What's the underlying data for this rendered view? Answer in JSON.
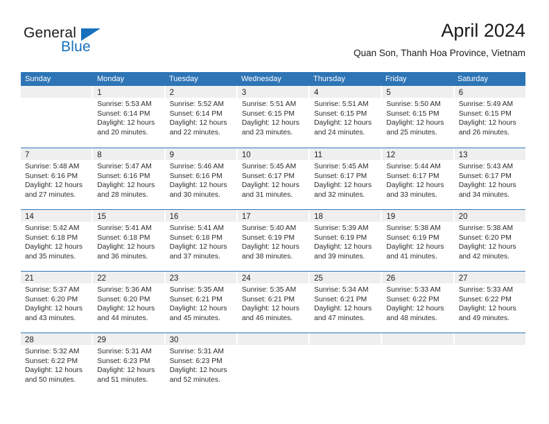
{
  "logo": {
    "word_top": "General",
    "word_bottom": "Blue",
    "triangle_color": "#1670bc",
    "blue_text_color": "#1670bc"
  },
  "header": {
    "title": "April 2024",
    "subtitle": "Quan Son, Thanh Hoa Province, Vietnam"
  },
  "theme": {
    "header_blue": "#2e75b6",
    "daynum_band": "#efefef",
    "text": "#2b2b2b"
  },
  "calendar": {
    "weekdays": [
      "Sunday",
      "Monday",
      "Tuesday",
      "Wednesday",
      "Thursday",
      "Friday",
      "Saturday"
    ],
    "weeks": [
      [
        {
          "day": "",
          "lines": []
        },
        {
          "day": "1",
          "lines": [
            "Sunrise: 5:53 AM",
            "Sunset: 6:14 PM",
            "Daylight: 12 hours",
            "and 20 minutes."
          ]
        },
        {
          "day": "2",
          "lines": [
            "Sunrise: 5:52 AM",
            "Sunset: 6:14 PM",
            "Daylight: 12 hours",
            "and 22 minutes."
          ]
        },
        {
          "day": "3",
          "lines": [
            "Sunrise: 5:51 AM",
            "Sunset: 6:15 PM",
            "Daylight: 12 hours",
            "and 23 minutes."
          ]
        },
        {
          "day": "4",
          "lines": [
            "Sunrise: 5:51 AM",
            "Sunset: 6:15 PM",
            "Daylight: 12 hours",
            "and 24 minutes."
          ]
        },
        {
          "day": "5",
          "lines": [
            "Sunrise: 5:50 AM",
            "Sunset: 6:15 PM",
            "Daylight: 12 hours",
            "and 25 minutes."
          ]
        },
        {
          "day": "6",
          "lines": [
            "Sunrise: 5:49 AM",
            "Sunset: 6:15 PM",
            "Daylight: 12 hours",
            "and 26 minutes."
          ]
        }
      ],
      [
        {
          "day": "7",
          "lines": [
            "Sunrise: 5:48 AM",
            "Sunset: 6:16 PM",
            "Daylight: 12 hours",
            "and 27 minutes."
          ]
        },
        {
          "day": "8",
          "lines": [
            "Sunrise: 5:47 AM",
            "Sunset: 6:16 PM",
            "Daylight: 12 hours",
            "and 28 minutes."
          ]
        },
        {
          "day": "9",
          "lines": [
            "Sunrise: 5:46 AM",
            "Sunset: 6:16 PM",
            "Daylight: 12 hours",
            "and 30 minutes."
          ]
        },
        {
          "day": "10",
          "lines": [
            "Sunrise: 5:45 AM",
            "Sunset: 6:17 PM",
            "Daylight: 12 hours",
            "and 31 minutes."
          ]
        },
        {
          "day": "11",
          "lines": [
            "Sunrise: 5:45 AM",
            "Sunset: 6:17 PM",
            "Daylight: 12 hours",
            "and 32 minutes."
          ]
        },
        {
          "day": "12",
          "lines": [
            "Sunrise: 5:44 AM",
            "Sunset: 6:17 PM",
            "Daylight: 12 hours",
            "and 33 minutes."
          ]
        },
        {
          "day": "13",
          "lines": [
            "Sunrise: 5:43 AM",
            "Sunset: 6:17 PM",
            "Daylight: 12 hours",
            "and 34 minutes."
          ]
        }
      ],
      [
        {
          "day": "14",
          "lines": [
            "Sunrise: 5:42 AM",
            "Sunset: 6:18 PM",
            "Daylight: 12 hours",
            "and 35 minutes."
          ]
        },
        {
          "day": "15",
          "lines": [
            "Sunrise: 5:41 AM",
            "Sunset: 6:18 PM",
            "Daylight: 12 hours",
            "and 36 minutes."
          ]
        },
        {
          "day": "16",
          "lines": [
            "Sunrise: 5:41 AM",
            "Sunset: 6:18 PM",
            "Daylight: 12 hours",
            "and 37 minutes."
          ]
        },
        {
          "day": "17",
          "lines": [
            "Sunrise: 5:40 AM",
            "Sunset: 6:19 PM",
            "Daylight: 12 hours",
            "and 38 minutes."
          ]
        },
        {
          "day": "18",
          "lines": [
            "Sunrise: 5:39 AM",
            "Sunset: 6:19 PM",
            "Daylight: 12 hours",
            "and 39 minutes."
          ]
        },
        {
          "day": "19",
          "lines": [
            "Sunrise: 5:38 AM",
            "Sunset: 6:19 PM",
            "Daylight: 12 hours",
            "and 41 minutes."
          ]
        },
        {
          "day": "20",
          "lines": [
            "Sunrise: 5:38 AM",
            "Sunset: 6:20 PM",
            "Daylight: 12 hours",
            "and 42 minutes."
          ]
        }
      ],
      [
        {
          "day": "21",
          "lines": [
            "Sunrise: 5:37 AM",
            "Sunset: 6:20 PM",
            "Daylight: 12 hours",
            "and 43 minutes."
          ]
        },
        {
          "day": "22",
          "lines": [
            "Sunrise: 5:36 AM",
            "Sunset: 6:20 PM",
            "Daylight: 12 hours",
            "and 44 minutes."
          ]
        },
        {
          "day": "23",
          "lines": [
            "Sunrise: 5:35 AM",
            "Sunset: 6:21 PM",
            "Daylight: 12 hours",
            "and 45 minutes."
          ]
        },
        {
          "day": "24",
          "lines": [
            "Sunrise: 5:35 AM",
            "Sunset: 6:21 PM",
            "Daylight: 12 hours",
            "and 46 minutes."
          ]
        },
        {
          "day": "25",
          "lines": [
            "Sunrise: 5:34 AM",
            "Sunset: 6:21 PM",
            "Daylight: 12 hours",
            "and 47 minutes."
          ]
        },
        {
          "day": "26",
          "lines": [
            "Sunrise: 5:33 AM",
            "Sunset: 6:22 PM",
            "Daylight: 12 hours",
            "and 48 minutes."
          ]
        },
        {
          "day": "27",
          "lines": [
            "Sunrise: 5:33 AM",
            "Sunset: 6:22 PM",
            "Daylight: 12 hours",
            "and 49 minutes."
          ]
        }
      ],
      [
        {
          "day": "28",
          "lines": [
            "Sunrise: 5:32 AM",
            "Sunset: 6:22 PM",
            "Daylight: 12 hours",
            "and 50 minutes."
          ]
        },
        {
          "day": "29",
          "lines": [
            "Sunrise: 5:31 AM",
            "Sunset: 6:23 PM",
            "Daylight: 12 hours",
            "and 51 minutes."
          ]
        },
        {
          "day": "30",
          "lines": [
            "Sunrise: 5:31 AM",
            "Sunset: 6:23 PM",
            "Daylight: 12 hours",
            "and 52 minutes."
          ]
        },
        {
          "day": "",
          "lines": []
        },
        {
          "day": "",
          "lines": []
        },
        {
          "day": "",
          "lines": []
        },
        {
          "day": "",
          "lines": []
        }
      ]
    ]
  }
}
